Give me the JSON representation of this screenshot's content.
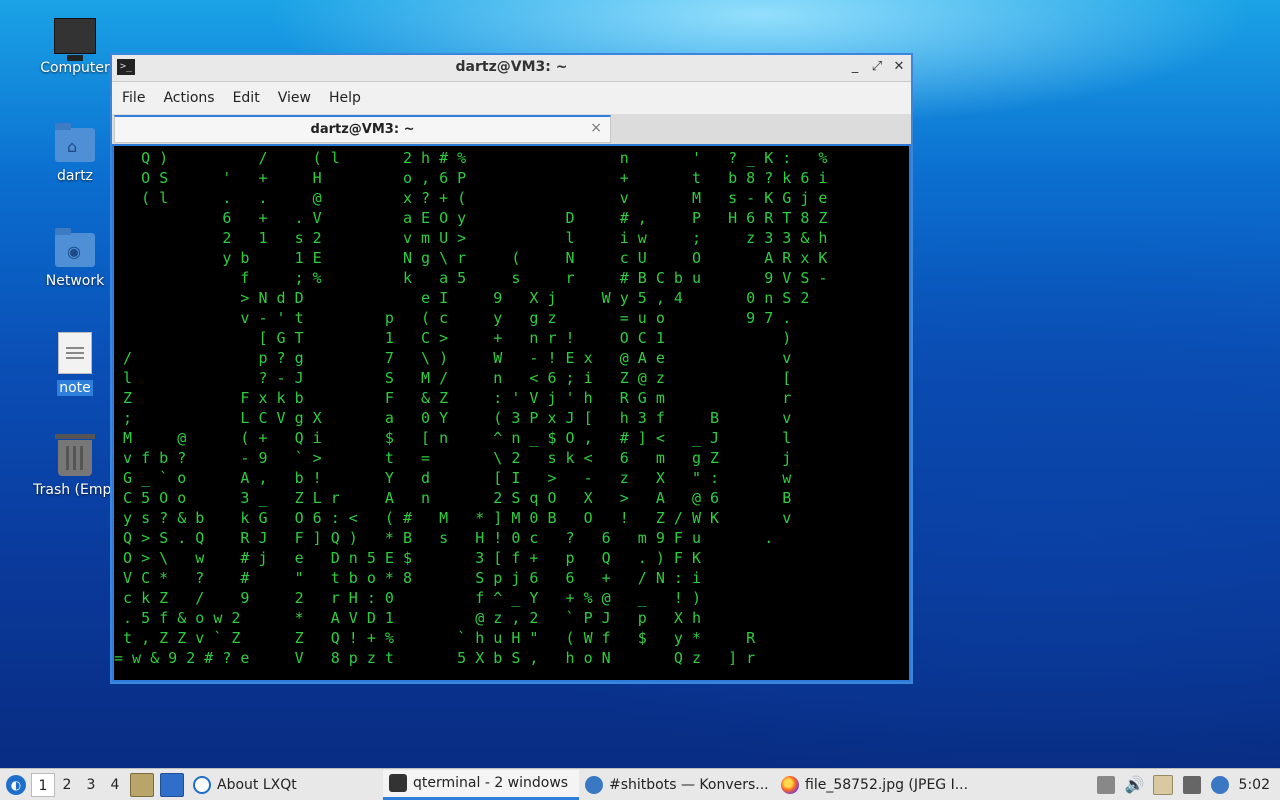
{
  "desktop": {
    "icons": [
      {
        "label": "Computer"
      },
      {
        "label": "dartz"
      },
      {
        "label": "Network"
      },
      {
        "label": "note"
      },
      {
        "label": "Trash (Empt"
      }
    ]
  },
  "window": {
    "title": "dartz@VM3: ~",
    "menu": [
      "File",
      "Actions",
      "Edit",
      "View",
      "Help"
    ],
    "tab_title": "dartz@VM3: ~",
    "tab_close": "×",
    "controls": {
      "minimize": "_",
      "maximize": "⤢",
      "close": "✕"
    },
    "terminal_lines": [
      "   Q )          /     ( l       2 h # %                 n       '   ? _ K :   %",
      "   O S      '   +     H         o , 6 P                 +       t   b 8 ? k 6 i",
      "   ( l      .   .     @         x ? + (                 v       M   s - K G j e",
      "            6   +   . V         a E O y           D     # ,     P   H 6 R T 8 Z",
      "            2   1   s 2         v m U >           l     i w     ;     z 3 3 & h",
      "            y b     1 E         N g \\ r     (     N     c U     O       A R x K",
      "              f     ; %         k   a 5     s     r     # B C b u       9 V S -",
      "              > N d D             e I     9   X j     W y 5 , 4       0 n S 2",
      "              v - ' t         p   ( c     y   g z       = u o         9 7 .",
      "                [ G T         1   C >     +   n r !     O C 1             )",
      " /              p ? g         7   \\ )     W   - ! E x   @ A e             v",
      " l              ? - J         S   M /     n   < 6 ; i   Z @ z             [",
      " Z            F x k b         F   & Z     : ' V j ' h   R G m             r",
      " ;            L C V g X       a   0 Y     ( 3 P x J [   h 3 f     B       v",
      " M     @      ( +   Q i       $   [ n     ^ n _ $ O ,   # ] <   _ J       l",
      " v f b ?      - 9   ` >       t   =       \\ 2   s k <   6   m   g Z       j",
      " G _ ` o      A ,   b !       Y   d       [ I   >   -   z   X   \" :       w",
      " C 5 O o      3 _   Z L r     A   n       2 S q O   X   >   A   @ 6       B",
      " y s ? & b    k G   O 6 : <   ( #   M   * ] M 0 B   O   !   Z / W K       v",
      " Q > S . Q    R J   F ] Q )   * B   s   H ! 0 c   ?   6   m 9 F u       .",
      " O > \\   w    # j   e   D n 5 E $       3 [ f +   p   Q   . ) F K",
      " V C *   ?    #     \"   t b o * 8       S p j 6   6   +   / N : i",
      " c k Z   /    9     2   r H : 0         f ^ _ Y   + % @   _   ! )",
      " . 5 f & o w 2      *   A V D 1         @ z , 2   ` P J   p   X h",
      " t , Z Z v ` Z      Z   Q ! + %       ` h u H \"   ( W f   $   y *     R",
      "= w & 9 2 # ? e     V   8 p z t       5 X b S ,   h o N       Q z   ] r"
    ]
  },
  "taskbar": {
    "desktops": [
      "1",
      "2",
      "3",
      "4"
    ],
    "tasks": [
      {
        "label": "About LXQt"
      },
      {
        "label": "qterminal - 2 windows"
      },
      {
        "label": "#shitbots — Konvers..."
      },
      {
        "label": "file_58752.jpg (JPEG I..."
      }
    ],
    "clock": "5:02"
  },
  "colors": {
    "terminal_fg": "#2ecc40",
    "terminal_bg": "#000000",
    "accent": "#2f7fdc"
  }
}
